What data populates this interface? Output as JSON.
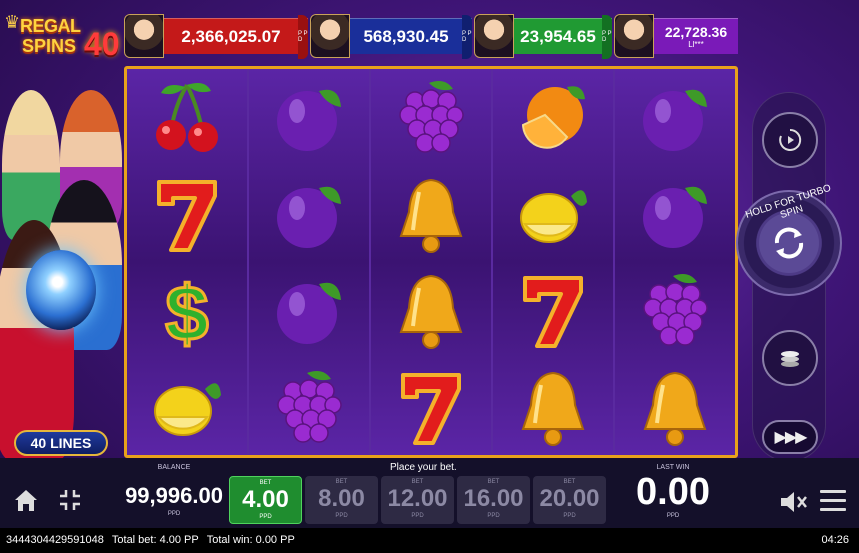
{
  "logo": {
    "line1": "REGAL",
    "line2": "SPINS",
    "number": "40"
  },
  "jackpots": [
    {
      "amount": "2,366,025.07",
      "color": "#c41919",
      "side": "P P D"
    },
    {
      "amount": "568,930.45",
      "color": "#1a2f9a",
      "side": "P P D"
    },
    {
      "amount": "23,954.65",
      "color": "#209a33",
      "side": "P P D"
    },
    {
      "amount": "22,728.36",
      "sub": "Ll***",
      "color": "#7a1ab8",
      "side": "P P D"
    }
  ],
  "lines_badge": "40 LINES",
  "reels": [
    [
      "cherries",
      "seven",
      "dollar",
      "lemon"
    ],
    [
      "plum",
      "plum",
      "plum",
      "grapes"
    ],
    [
      "grapes",
      "bell",
      "bell",
      "seven"
    ],
    [
      "orange",
      "lemon",
      "seven",
      "bell"
    ],
    [
      "plum",
      "plum",
      "grapes",
      "bell"
    ]
  ],
  "controls": {
    "autoplay_icon": "autoplay-icon",
    "spin_label": "HOLD FOR TURBO SPIN",
    "coins_icon": "coins-icon",
    "fast_forward": "▶▶▶"
  },
  "bottom": {
    "balance_label": "BALANCE",
    "balance_value": "99,996.00",
    "balance_currency": "PPD",
    "place_bet": "Place your bet.",
    "bets": [
      {
        "label": "BET",
        "value": "4.00",
        "currency": "PPD",
        "selected": true
      },
      {
        "label": "BET",
        "value": "8.00",
        "currency": "PPD",
        "selected": false
      },
      {
        "label": "BET",
        "value": "12.00",
        "currency": "PPD",
        "selected": false
      },
      {
        "label": "BET",
        "value": "16.00",
        "currency": "PPD",
        "selected": false
      },
      {
        "label": "BET",
        "value": "20.00",
        "currency": "PPD",
        "selected": false
      }
    ],
    "lastwin_label": "LAST WIN",
    "lastwin_value": "0.00",
    "lastwin_currency": "PPD"
  },
  "status": {
    "round_id": "3444304429591048",
    "total_bet": "Total bet: 4.00 PP",
    "total_win": "Total win: 0.00 PP",
    "time": "04:26"
  }
}
